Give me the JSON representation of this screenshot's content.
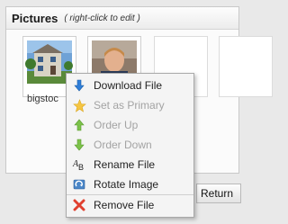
{
  "panel": {
    "title": "Pictures",
    "hint": "( right-click to edit )"
  },
  "thumbnails": [
    {
      "caption": "bigstoc"
    },
    {
      "caption": ""
    }
  ],
  "footer": {
    "return_label": "Return"
  },
  "context_menu": {
    "items": [
      {
        "label": "Download File",
        "enabled": true,
        "icon": "arrow-down-icon"
      },
      {
        "label": "Set as Primary",
        "enabled": false,
        "icon": "star-icon"
      },
      {
        "label": "Order Up",
        "enabled": false,
        "icon": "arrow-up-icon"
      },
      {
        "label": "Order Down",
        "enabled": false,
        "icon": "arrow-down-green-icon"
      },
      {
        "label": "Rename File",
        "enabled": true,
        "icon": "rename-icon"
      },
      {
        "label": "Rotate Image",
        "enabled": true,
        "icon": "rotate-icon"
      },
      {
        "label": "Remove File",
        "enabled": true,
        "icon": "remove-icon"
      }
    ]
  }
}
